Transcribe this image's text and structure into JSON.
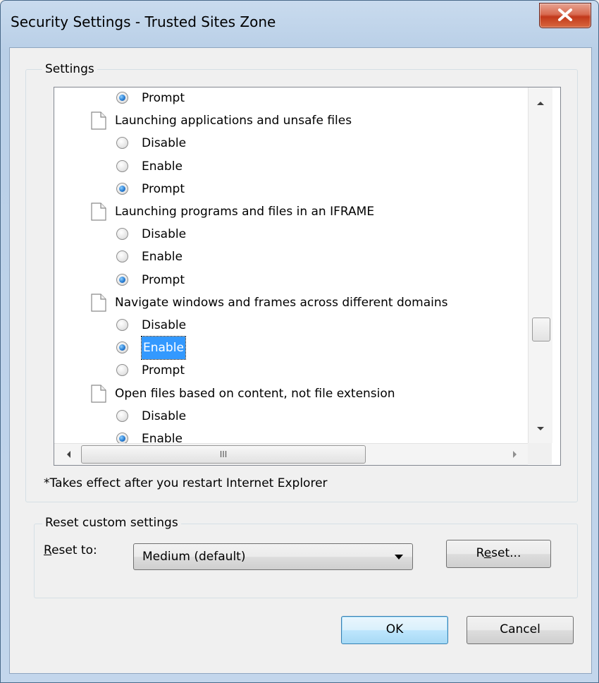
{
  "window": {
    "title": "Security Settings - Trusted Sites Zone",
    "close_icon": "close-icon"
  },
  "settings": {
    "group_label": "Settings",
    "items": [
      {
        "type": "radio",
        "label": "Prompt",
        "checked": true
      },
      {
        "type": "setting",
        "label": "Launching applications and unsafe files"
      },
      {
        "type": "radio",
        "label": "Disable",
        "checked": false
      },
      {
        "type": "radio",
        "label": "Enable",
        "checked": false
      },
      {
        "type": "radio",
        "label": "Prompt",
        "checked": true
      },
      {
        "type": "setting",
        "label": "Launching programs and files in an IFRAME"
      },
      {
        "type": "radio",
        "label": "Disable",
        "checked": false
      },
      {
        "type": "radio",
        "label": "Enable",
        "checked": false
      },
      {
        "type": "radio",
        "label": "Prompt",
        "checked": true
      },
      {
        "type": "setting",
        "label": "Navigate windows and frames across different domains"
      },
      {
        "type": "radio",
        "label": "Disable",
        "checked": false
      },
      {
        "type": "radio",
        "label": "Enable",
        "checked": true,
        "selected": true
      },
      {
        "type": "radio",
        "label": "Prompt",
        "checked": false
      },
      {
        "type": "setting",
        "label": "Open files based on content, not file extension"
      },
      {
        "type": "radio",
        "label": "Disable",
        "checked": false
      },
      {
        "type": "radio",
        "label": "Enable",
        "checked": true
      }
    ],
    "hscroll_grip": "III",
    "note": "*Takes effect after you restart Internet Explorer"
  },
  "reset": {
    "group_label": "Reset custom settings",
    "reset_to_prefix": "R",
    "reset_to_rest": "eset to:",
    "combo_value": "Medium (default)",
    "reset_button_pre": "R",
    "reset_button_u": "e",
    "reset_button_post": "set..."
  },
  "buttons": {
    "ok": "OK",
    "cancel": "Cancel"
  },
  "colors": {
    "selection": "#3399ff",
    "radio_dot": "#2a7fd4",
    "close_button": "#c2391b"
  }
}
